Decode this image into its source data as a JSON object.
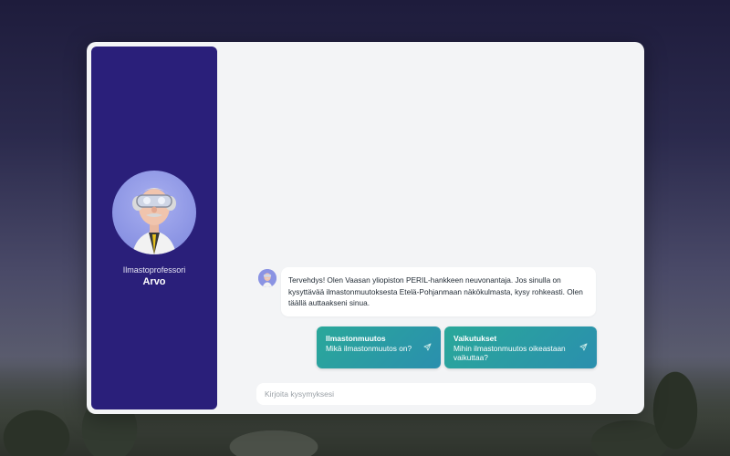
{
  "assistant": {
    "role": "Ilmastoprofessori",
    "name": "Arvo"
  },
  "messages": [
    {
      "sender": "assistant",
      "text": "Tervehdys! Olen Vaasan yliopiston PERIL-hankkeen neuvonantaja. Jos sinulla on kysyttävää ilmastonmuutoksesta Etelä-Pohjanmaan näkökulmasta, kysy rohkeasti. Olen täällä auttaakseni sinua."
    }
  ],
  "suggestions": [
    {
      "title": "Ilmastonmuutos",
      "text": "Mikä ilmastonmuutos on?",
      "icon": "send-icon"
    },
    {
      "title": "Vaikutukset",
      "text": "Mihin ilmastonmuutos oikeastaan vaikuttaa?",
      "icon": "send-icon"
    }
  ],
  "input": {
    "placeholder": "Kirjoita kysymyksesi",
    "value": ""
  },
  "colors": {
    "sidebar": "#2a1f7a",
    "suggestion_start": "#2aa89a",
    "suggestion_end": "#2a8fae",
    "panel": "#f3f4f6"
  }
}
